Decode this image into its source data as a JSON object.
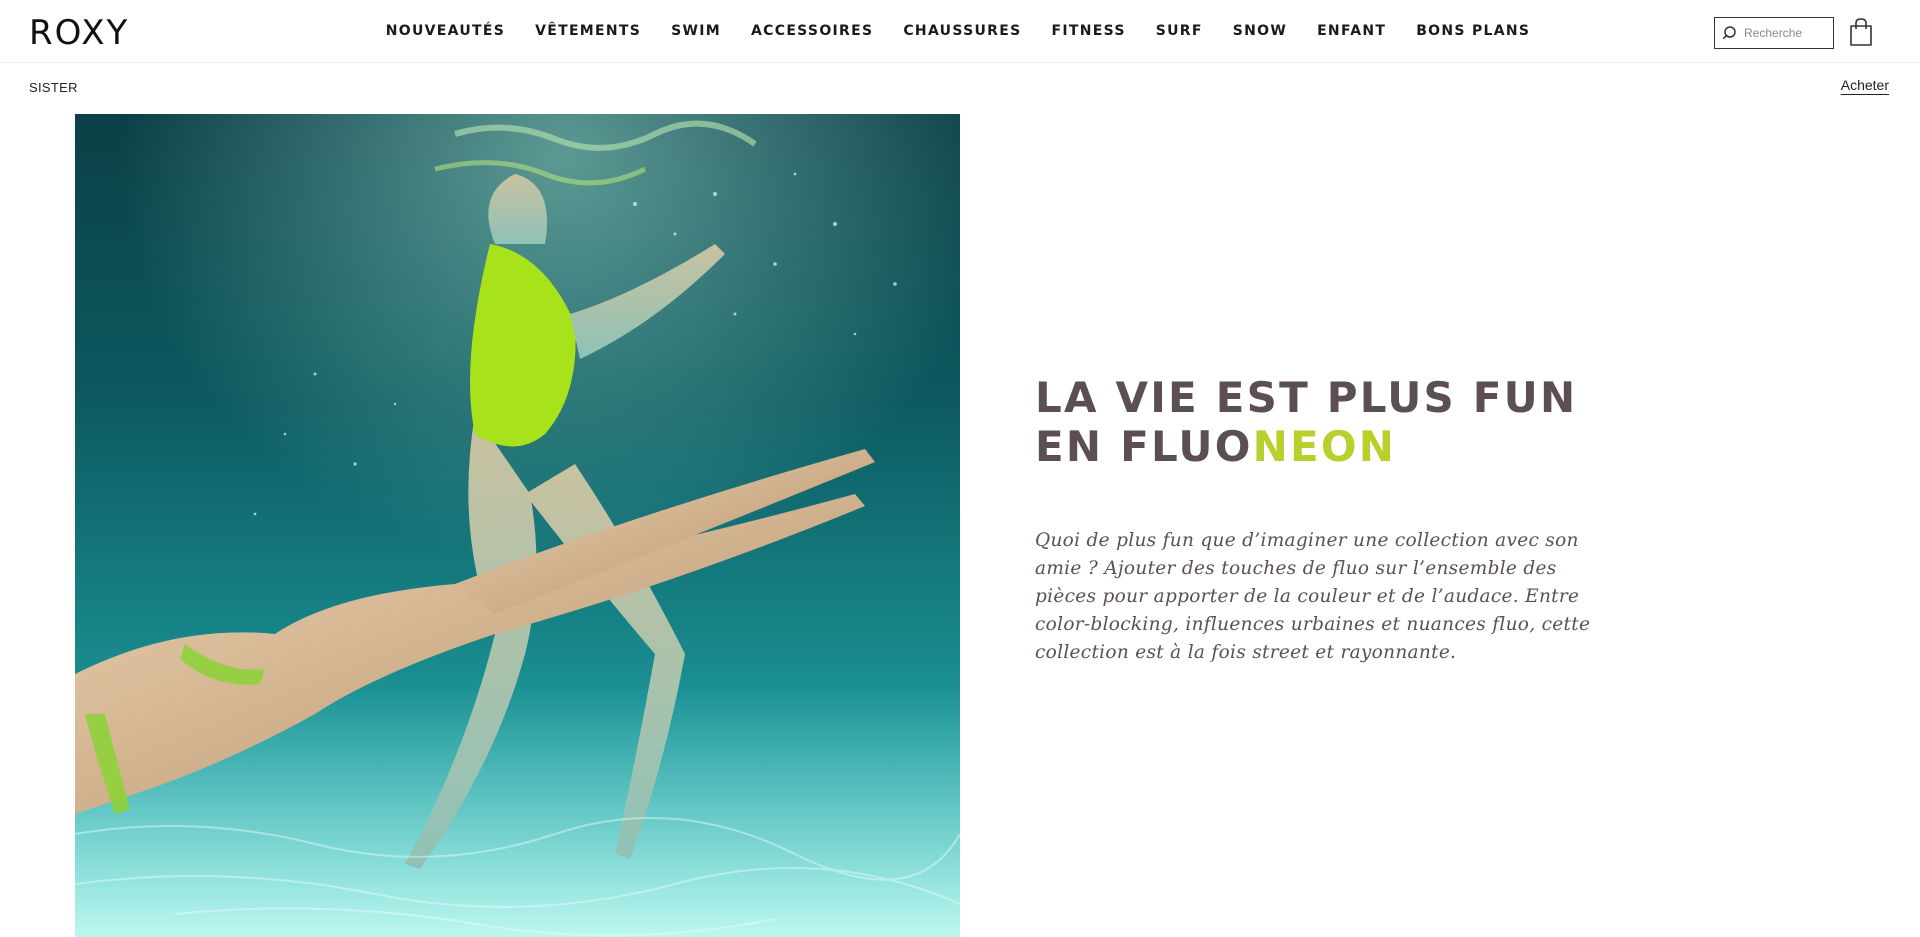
{
  "header": {
    "logo": "ROXY",
    "nav": [
      {
        "label": "NOUVEAUTÉS"
      },
      {
        "label": "VÊTEMENTS"
      },
      {
        "label": "SWIM"
      },
      {
        "label": "ACCESSOIRES"
      },
      {
        "label": "CHAUSSURES"
      },
      {
        "label": "FITNESS"
      },
      {
        "label": "SURF"
      },
      {
        "label": "SNOW"
      },
      {
        "label": "ENFANT"
      },
      {
        "label": "BONS PLANS"
      }
    ],
    "search": {
      "placeholder": "Recherche",
      "value": "",
      "icon": "search-icon"
    },
    "cart": {
      "icon": "shopping-bag-icon"
    }
  },
  "subbar": {
    "title": "SISTER",
    "link": "Acheter"
  },
  "hero": {
    "image": {
      "description_icon": "underwater-swimmers-photo"
    },
    "headline_part1": "LA VIE EST PLUS FUN EN FLUO",
    "headline_accent": "NEON",
    "body": "Quoi de plus fun que d’imaginer une collection avec son amie ? Ajouter des touches de fluo sur l’ensemble des pièces pour apporter de la couleur et de l’audace. Entre color-blocking, influences urbaines et nuances fluo, cette collection est à la fois street et rayonnante."
  },
  "colors": {
    "headline": "#5b4e55",
    "accent": "#b9cf2c",
    "water_deep": "#0b4a52",
    "water_light": "#3fc4c4"
  }
}
